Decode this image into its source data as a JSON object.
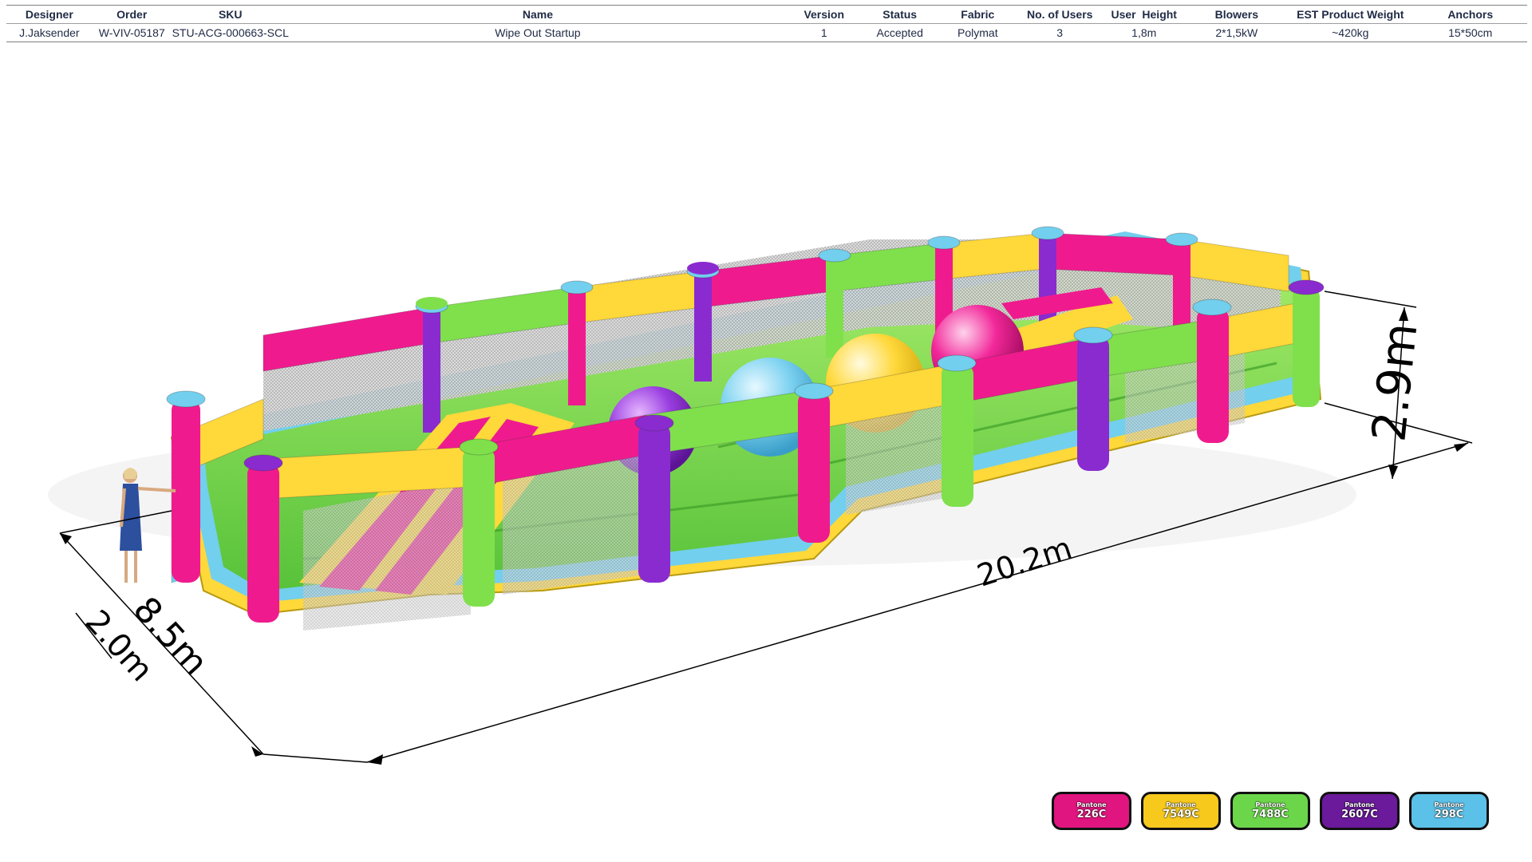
{
  "spec_table": {
    "headers": [
      "Designer",
      "Order",
      "SKU",
      "Name",
      "Version",
      "Status",
      "Fabric",
      "No. of Users",
      "User  Height",
      "Blowers",
      "EST Product Weight",
      "Anchors"
    ],
    "row": [
      "J.Jaksender",
      "W-VIV-05187",
      "STU-ACG-000663-SCL",
      "Wipe Out Startup",
      "1",
      "Accepted",
      "Polymat",
      "3",
      "1,8m",
      "2*1,5kW",
      "~420kg",
      "15*50cm"
    ]
  },
  "dimensions": {
    "length": "20.2m",
    "width": "8.5m",
    "depth": "2.0m",
    "height": "2.9m"
  },
  "swatches": [
    {
      "label": "Pantone",
      "code": "226C",
      "color": "#e0157f"
    },
    {
      "label": "Pantone",
      "code": "7549C",
      "color": "#f7c91d"
    },
    {
      "label": "Pantone",
      "code": "7488C",
      "color": "#6cd64a"
    },
    {
      "label": "Pantone",
      "code": "2607C",
      "color": "#6a1a9a"
    },
    {
      "label": "Pantone",
      "code": "298C",
      "color": "#5cc1e8"
    }
  ],
  "colors": {
    "pink": "#ef1b8e",
    "yellow": "#ffd83a",
    "green": "#7fe04c",
    "purple": "#8a2bd0",
    "blue": "#72cfee"
  }
}
